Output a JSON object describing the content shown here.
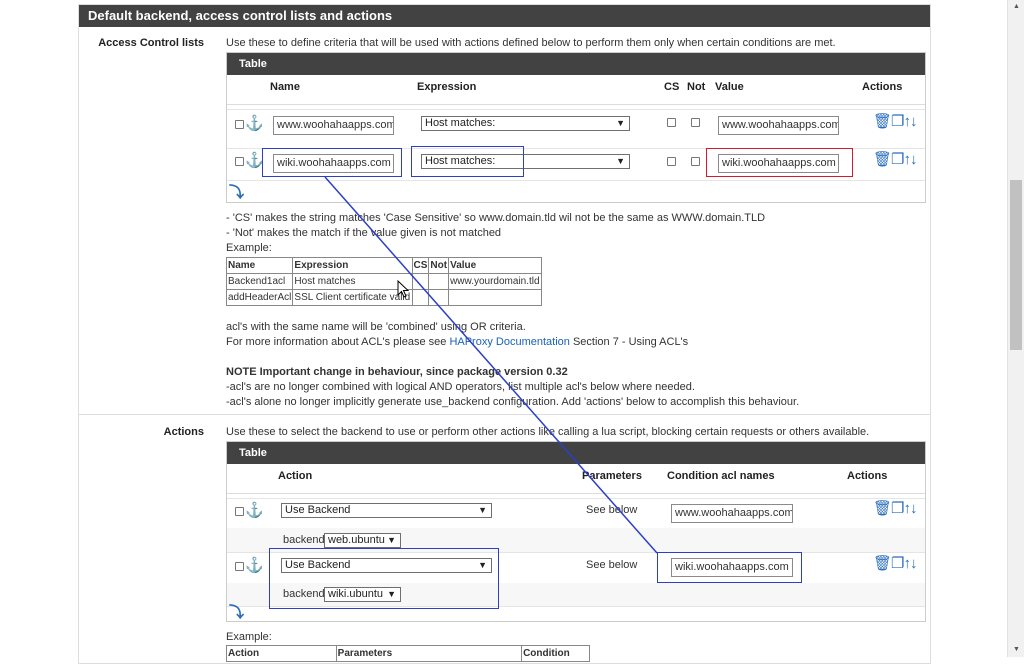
{
  "panel": {
    "title": "Default backend, access control lists and actions"
  },
  "acl": {
    "label": "Access Control lists",
    "description": "Use these to define criteria that will be used with actions defined below to perform them only when certain conditions are met.",
    "table_title": "Table",
    "columns": {
      "name": "Name",
      "expression": "Expression",
      "cs": "CS",
      "not": "Not",
      "value": "Value",
      "actions": "Actions"
    },
    "rows": [
      {
        "name": "www.woohahaapps.com",
        "expression": "Host matches:",
        "value": "www.woohahaapps.com"
      },
      {
        "name": "wiki.woohahaapps.com",
        "expression": "Host matches:",
        "value": "wiki.woohahaapps.com"
      }
    ],
    "notes": [
      "- 'CS' makes the string matches 'Case Sensitive' so www.domain.tld wil not be the same as WWW.domain.TLD",
      "- 'Not' makes the match if the value given is not matched",
      "Example:"
    ],
    "example": {
      "headers": [
        "Name",
        "Expression",
        "CS",
        "Not",
        "Value"
      ],
      "rows": [
        [
          "Backend1acl",
          "Host matches",
          "",
          "",
          "www.yourdomain.tld"
        ],
        [
          "addHeaderAcl",
          "SSL Client certificate valid",
          "",
          "",
          ""
        ]
      ]
    },
    "combined_note": "acl's with the same name will be 'combined' using OR criteria.",
    "more_info_prefix": "For more information about ACL's please see ",
    "more_info_link": "HAProxy Documentation",
    "more_info_suffix": " Section 7 - Using ACL's",
    "note_title": "NOTE Important change in behaviour, since package version 0.32",
    "note_line1": "-acl's are no longer combined with logical AND operators, list multiple acl's below where needed.",
    "note_line2": "-acl's alone no longer implicitly generate use_backend configuration. Add 'actions' below to accomplish this behaviour."
  },
  "actions": {
    "label": "Actions",
    "description": "Use these to select the backend to use or perform other actions like calling a lua script, blocking certain requests or others available.",
    "table_title": "Table",
    "columns": {
      "action": "Action",
      "parameters": "Parameters",
      "condition": "Condition acl names",
      "actions": "Actions"
    },
    "rows": [
      {
        "action": "Use Backend",
        "parameters": "See below",
        "condition": "www.woohahaapps.com",
        "backend_label": "backend:",
        "backend": "web.ubuntu"
      },
      {
        "action": "Use Backend",
        "parameters": "See below",
        "condition": "wiki.woohahaapps.com",
        "backend_label": "backend:",
        "backend": "wiki.ubuntu"
      }
    ],
    "example_label": "Example:",
    "example_headers": [
      "Action",
      "Parameters",
      "Condition"
    ]
  },
  "icons": {
    "anchor": "anchor-icon",
    "delete": "trash-icon",
    "copy": "copy-icon",
    "move_up": "arrow-up-icon",
    "move_down": "arrow-down-icon",
    "add": "add-row-icon"
  },
  "colors": {
    "header_bg": "#424242",
    "accent": "#2a6ebb",
    "annotation_blue": "#2b3fc8",
    "annotation_red": "#d9182d"
  }
}
